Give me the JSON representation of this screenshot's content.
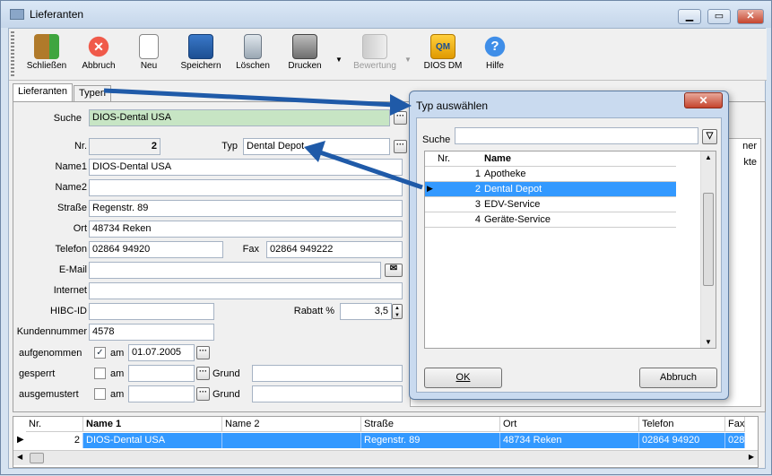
{
  "window": {
    "title": "Lieferanten",
    "min": "▁",
    "max": "▭",
    "close": "✕"
  },
  "toolbar": [
    {
      "label": "Schließen",
      "icon": "exit-door-icon"
    },
    {
      "label": "Abbruch",
      "icon": "cancel-icon"
    },
    {
      "label": "Neu",
      "icon": "new-document-icon"
    },
    {
      "label": "Speichern",
      "icon": "save-icon"
    },
    {
      "label": "Löschen",
      "icon": "trash-icon"
    },
    {
      "label": "Drucken",
      "icon": "printer-icon"
    },
    {
      "label": "Bewertung",
      "icon": "rating-icon"
    },
    {
      "label": "DIOS DM",
      "icon": "dios-dm-icon",
      "badge": "QM"
    },
    {
      "label": "Hilfe",
      "icon": "help-icon"
    }
  ],
  "tabs": [
    "Lieferanten",
    "Typen"
  ],
  "form": {
    "suche_label": "Suche",
    "suche_value": "DIOS-Dental USA",
    "nr_label": "Nr.",
    "nr_value": "2",
    "typ_label": "Typ",
    "typ_value": "Dental Depot",
    "name1_label": "Name1",
    "name1_value": "DIOS-Dental USA",
    "name2_label": "Name2",
    "name2_value": "",
    "strasse_label": "Straße",
    "strasse_value": "Regenstr. 89",
    "ort_label": "Ort",
    "ort_value": "48734 Reken",
    "telefon_label": "Telefon",
    "telefon_value": "02864 94920",
    "fax_label": "Fax",
    "fax_value": "02864 949222",
    "email_label": "E-Mail",
    "email_value": "",
    "internet_label": "Internet",
    "internet_value": "",
    "hibc_label": "HIBC-ID",
    "hibc_value": "",
    "rabatt_label": "Rabatt %",
    "rabatt_value": "3,5",
    "kundennr_label": "Kundennummer",
    "kundennr_value": "4578",
    "aufgenommen_label": "aufgenommen",
    "aufgenommen_checked": "✓",
    "am_label": "am",
    "aufgenommen_date": "01.07.2005",
    "gesperrt_label": "gesperrt",
    "ausgemustert_label": "ausgemustert",
    "grund_label": "Grund"
  },
  "grid": {
    "headers": [
      "Nr.",
      "Name 1",
      "Name 2",
      "Straße",
      "Ort",
      "Telefon",
      "Fax"
    ],
    "row": [
      "2",
      "DIOS-Dental USA",
      "",
      "Regenstr. 89",
      "48734 Reken",
      "02864 94920",
      "028"
    ]
  },
  "dialog": {
    "title": "Typ auswählen",
    "close": "✕",
    "suche_label": "Suche",
    "list_headers": [
      "Nr.",
      "Name"
    ],
    "items": [
      {
        "nr": "1",
        "name": "Apotheke"
      },
      {
        "nr": "2",
        "name": "Dental Depot"
      },
      {
        "nr": "3",
        "name": "EDV-Service"
      },
      {
        "nr": "4",
        "name": "Geräte-Service"
      }
    ],
    "ok": "OK",
    "cancel": "Abbruch"
  },
  "hidden_tab_fragments": [
    "ner",
    "kte"
  ],
  "colors": {
    "selection": "#3399ff",
    "search_field": "#c7e5c4",
    "arrow": "#1f5aa8"
  }
}
